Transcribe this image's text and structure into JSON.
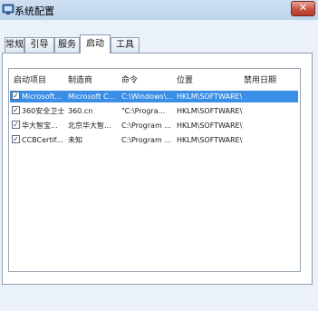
{
  "window": {
    "title": "系统配置",
    "close_glyph": "✕",
    "icon": "system-config-icon"
  },
  "tabs": [
    {
      "label": "常规",
      "active": false
    },
    {
      "label": "引导",
      "active": false
    },
    {
      "label": "服务",
      "active": false
    },
    {
      "label": "启动",
      "active": true
    },
    {
      "label": "工具",
      "active": false
    }
  ],
  "startup_list": {
    "columns": [
      "启动项目",
      "制造商",
      "命令",
      "位置",
      "禁用日期"
    ],
    "rows": [
      {
        "checked": true,
        "item": "Microsoft...",
        "maker": "Microsoft C...",
        "command": "C:\\Windows\\...",
        "location": "HKLM\\SOFTWARE\\M...",
        "disabled_date": "",
        "selected": true
      },
      {
        "checked": true,
        "item": "360安全卫士",
        "maker": "360.cn",
        "command": "\"C:\\Progra...",
        "location": "HKLM\\SOFTWARE\\W...",
        "disabled_date": "",
        "selected": false
      },
      {
        "checked": true,
        "item": "华大智宝...",
        "maker": "北京华大智...",
        "command": "C:\\Program ...",
        "location": "HKLM\\SOFTWARE\\W...",
        "disabled_date": "",
        "selected": false
      },
      {
        "checked": true,
        "item": "CCBCertif...",
        "maker": "未知",
        "command": "C:\\Program ...",
        "location": "HKLM\\SOFTWARE\\W...",
        "disabled_date": "",
        "selected": false
      }
    ]
  },
  "colors": {
    "selection": "#3a8ee6",
    "close_button": "#c75240",
    "title_bar": "#bcd3ec"
  }
}
